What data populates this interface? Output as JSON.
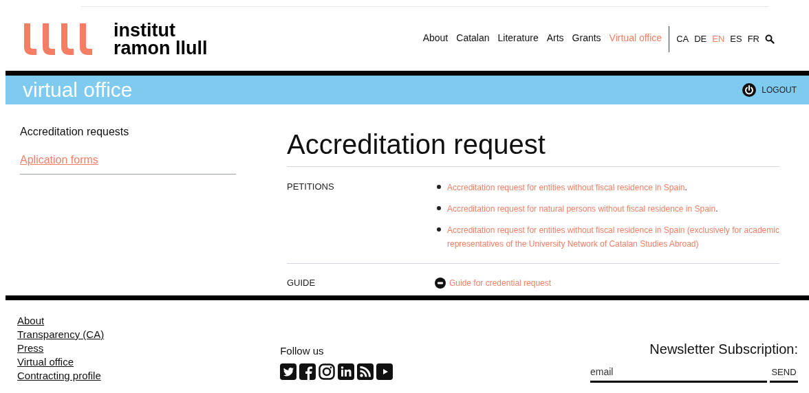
{
  "header": {
    "logo_text": [
      "institut",
      "ramon llull"
    ],
    "nav": [
      {
        "label": "About",
        "selected": false
      },
      {
        "label": "Catalan",
        "selected": false
      },
      {
        "label": "Literature",
        "selected": false
      },
      {
        "label": "Arts",
        "selected": false
      },
      {
        "label": "Grants",
        "selected": false
      },
      {
        "label": "Virtual office",
        "selected": true
      }
    ],
    "languages": [
      {
        "label": "CA",
        "selected": false
      },
      {
        "label": "DE",
        "selected": false
      },
      {
        "label": "EN",
        "selected": true
      },
      {
        "label": "ES",
        "selected": false
      },
      {
        "label": "FR",
        "selected": false
      }
    ]
  },
  "banner": {
    "title": "virtual office",
    "logout": "LOGOUT"
  },
  "sidebar": {
    "items": [
      {
        "label": "Accreditation requests",
        "selected": false
      },
      {
        "label": "Aplication forms",
        "selected": true
      }
    ]
  },
  "main": {
    "title": "Accreditation request",
    "sections": [
      {
        "label": "PETITIONS",
        "kind": "list",
        "items": [
          {
            "link": "Accreditation request for entities without fiscal residence in Spain",
            "suffix": "."
          },
          {
            "link": "Accreditation request for natural persons without fiscal residence in Spain",
            "suffix": "."
          },
          {
            "link": "Accreditation request for entities without fiscal residence in Spain (exclusively for academic representatives of the University Network of Catalan Studies Abroad)"
          }
        ]
      },
      {
        "label": "GUIDE",
        "kind": "document",
        "items": [
          {
            "link": "Guide for credential request"
          }
        ]
      }
    ]
  },
  "footer": {
    "links": [
      "About",
      "Transparency (CA)",
      "Press",
      "Virtual office",
      "Contracting profile"
    ],
    "follow": "Follow us",
    "newsletter": {
      "title": "Newsletter Subscription:",
      "placeholder": "email",
      "button": "SEND"
    }
  }
}
